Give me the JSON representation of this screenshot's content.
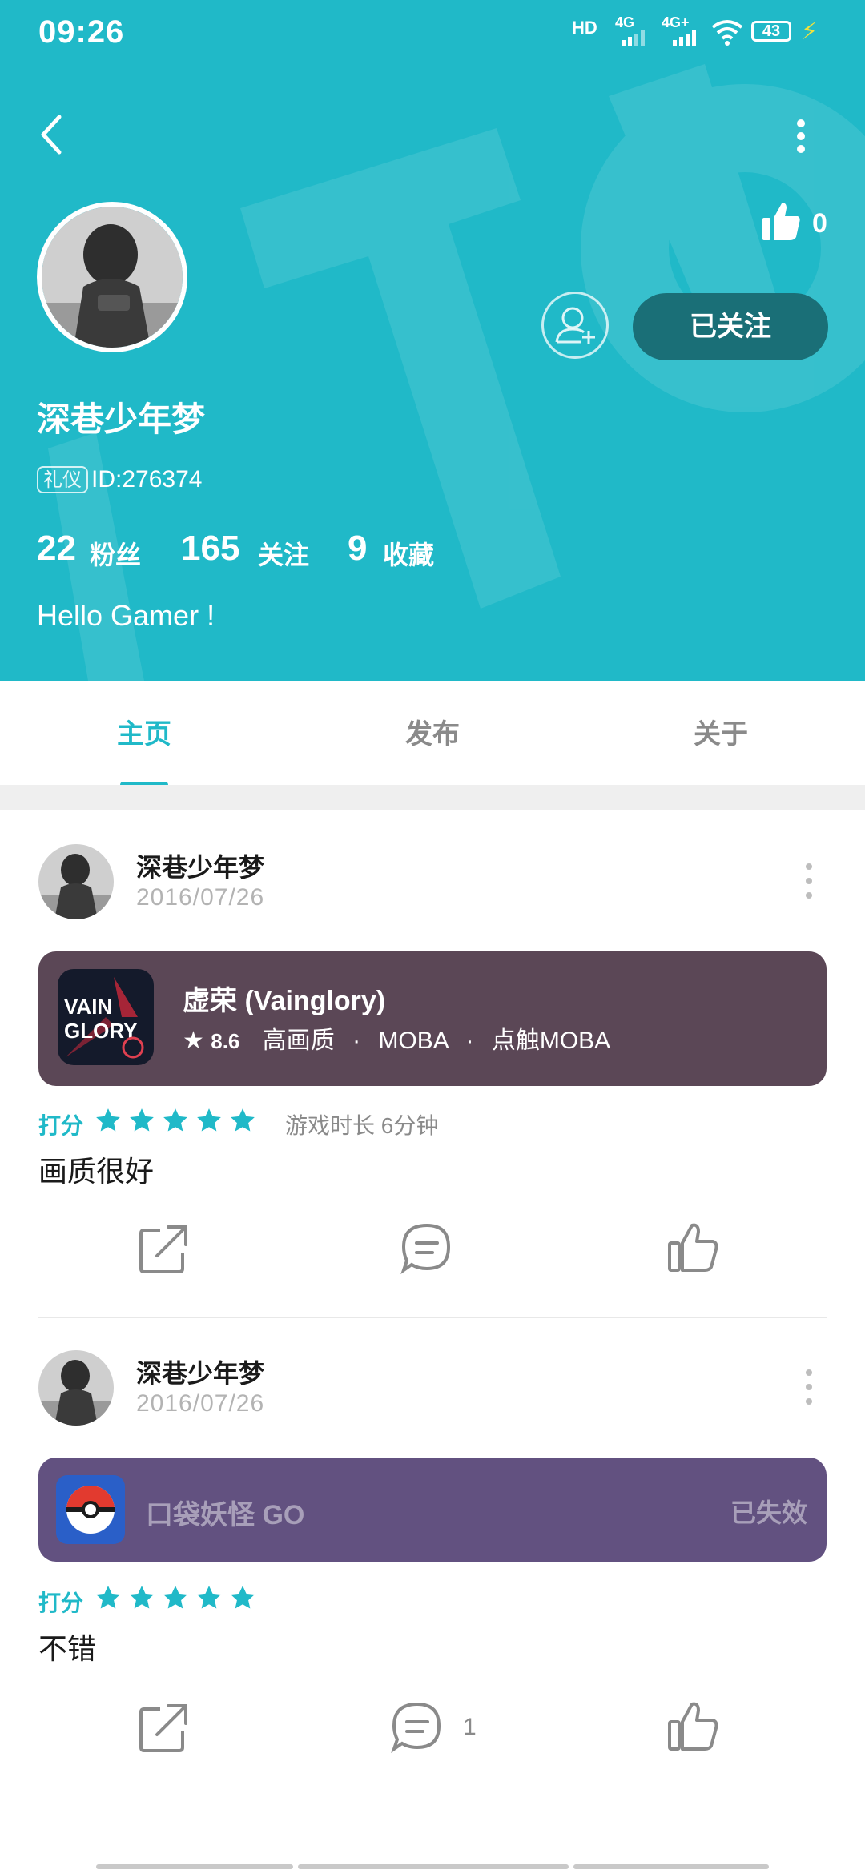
{
  "status_bar": {
    "time": "09:26",
    "indicators": [
      "HD",
      "4G",
      "4G+"
    ],
    "battery": "43"
  },
  "profile": {
    "name": "深巷少年梦",
    "badge": "礼仪",
    "id": "ID:276374",
    "like_count": "0",
    "follow_label": "已关注",
    "stats": [
      {
        "value": "22",
        "label": "粉丝"
      },
      {
        "value": "165",
        "label": "关注"
      },
      {
        "value": "9",
        "label": "收藏"
      }
    ],
    "bio": "Hello Gamer !"
  },
  "tabs": [
    {
      "label": "主页",
      "active": true
    },
    {
      "label": "发布",
      "active": false
    },
    {
      "label": "关于",
      "active": false
    }
  ],
  "posts": [
    {
      "user": "深巷少年梦",
      "date": "2016/07/26",
      "game": {
        "title": "虚荣 (Vainglory)",
        "rating": "8.6",
        "tags": [
          "高画质",
          "MOBA",
          "点触MOBA"
        ],
        "icon_text": "VAIN GLORY"
      },
      "rate_label": "打分",
      "stars": 5,
      "playtime": "游戏时长 6分钟",
      "review": "画质很好",
      "comment_count": ""
    },
    {
      "user": "深巷少年梦",
      "date": "2016/07/26",
      "game": {
        "title": "口袋妖怪 GO",
        "status": "已失效"
      },
      "rate_label": "打分",
      "stars": 5,
      "review": "不错",
      "comment_count": "1"
    }
  ],
  "colors": {
    "accent": "#20b9c8",
    "follow_button": "#1a6f77",
    "card_vainglory": "#5b4756",
    "card_pokemon": "#625180"
  },
  "icons": [
    "back-icon",
    "more-icon",
    "thumbs-up-icon",
    "add-friend-icon",
    "share-icon",
    "comment-icon",
    "star-icon"
  ]
}
